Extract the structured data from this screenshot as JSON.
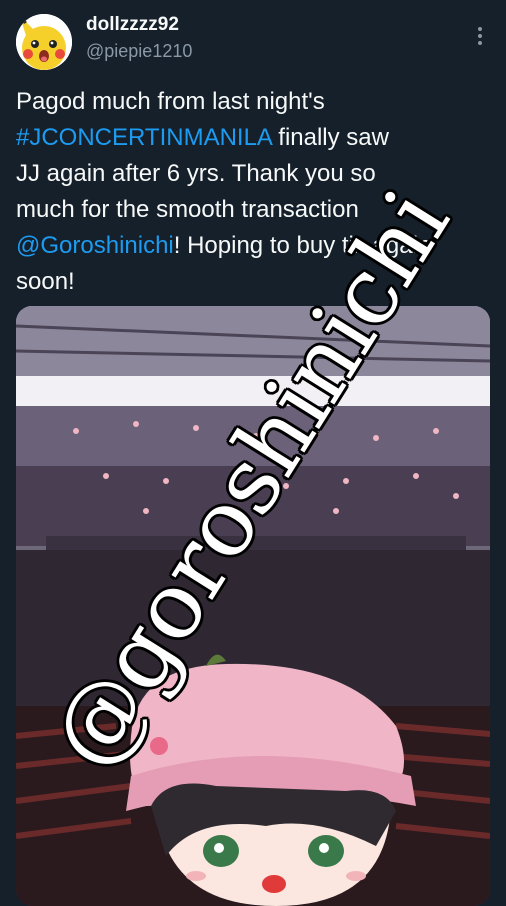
{
  "post": {
    "author": {
      "display_name": "dollzzzz92",
      "handle": "@piepie1210",
      "avatar_icon": "pikachu-avatar"
    },
    "more_icon": "more-vertical-icon",
    "text": {
      "line1": "Pagod much from last night's",
      "hashtag": "#JCONCERTINMANILA",
      "line2_rest": " finally saw",
      "line3": "JJ again after 6 yrs. Thank you so",
      "line4": "much for the smooth transaction",
      "mention": "@Goroshinichi",
      "line5_rest": "! Hoping to buy tix again",
      "line6": "soon!"
    },
    "media": {
      "watermark": "@goroshinichi"
    }
  },
  "colors": {
    "background": "#15202b",
    "text": "#f7f9f9",
    "secondary_text": "#8b98a5",
    "link": "#1d9bf0"
  }
}
